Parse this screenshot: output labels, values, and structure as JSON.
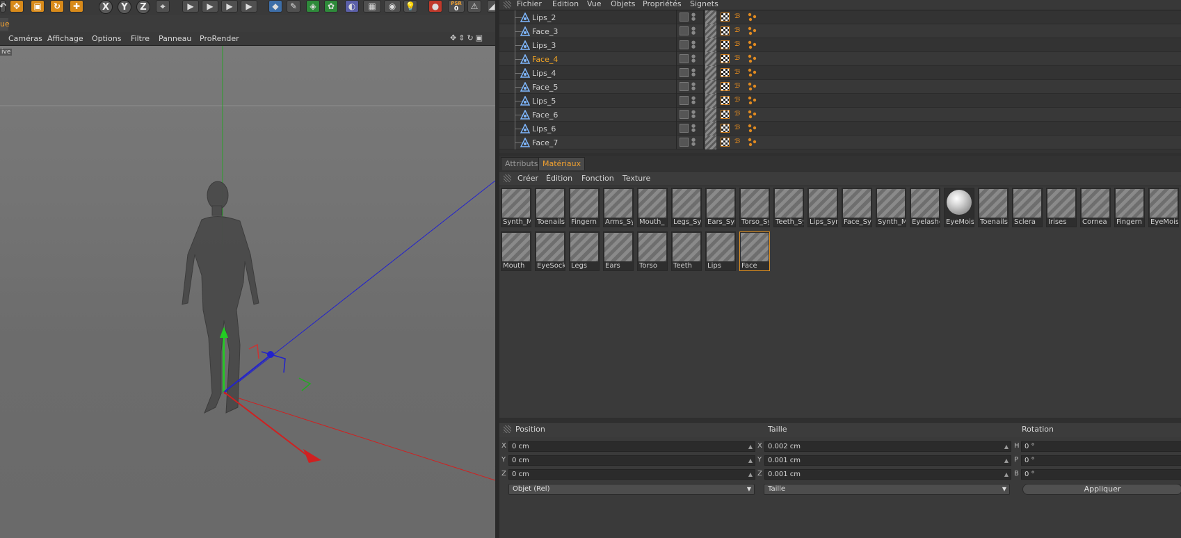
{
  "toolbar": {
    "axis_x": "X",
    "axis_y": "Y",
    "axis_z": "Z",
    "psr_label": "PSR",
    "psr_value": "0"
  },
  "viewport": {
    "tab_label": "ue",
    "menu": [
      "Caméras",
      "Affichage",
      "Options",
      "Filtre",
      "Panneau",
      "ProRender"
    ],
    "label": "ive"
  },
  "object_manager": {
    "menu": [
      "Fichier",
      "Edition",
      "Vue",
      "Objets",
      "Propriétés",
      "Signets"
    ],
    "objects": [
      {
        "name": "Lips_2",
        "selected": false
      },
      {
        "name": "Face_3",
        "selected": false
      },
      {
        "name": "Lips_3",
        "selected": false
      },
      {
        "name": "Face_4",
        "selected": true
      },
      {
        "name": "Lips_4",
        "selected": false
      },
      {
        "name": "Face_5",
        "selected": false
      },
      {
        "name": "Lips_5",
        "selected": false
      },
      {
        "name": "Face_6",
        "selected": false
      },
      {
        "name": "Lips_6",
        "selected": false
      },
      {
        "name": "Face_7",
        "selected": false
      }
    ]
  },
  "panel_tabs": [
    {
      "label": "Attributs",
      "active": false
    },
    {
      "label": "Matériaux",
      "active": true
    }
  ],
  "material_manager": {
    "menu": [
      "Créer",
      "Édition",
      "Fonction",
      "Texture"
    ],
    "row1": [
      "Synth_M",
      "Toenails",
      "Fingern",
      "Arms_Sy",
      "Mouth_",
      "Legs_Sy",
      "Ears_Syn",
      "Torso_Sy",
      "Teeth_Sy",
      "Lips_Syn",
      "Face_Syn",
      "Synth_M",
      "Eyelashe",
      "EyeMois",
      "Toenails",
      "Sclera",
      "Irises",
      "Cornea",
      "Fingern",
      "EyeMois"
    ],
    "row2": [
      "Mouth",
      "EyeSock",
      "Legs",
      "Ears",
      "Torso",
      "Teeth",
      "Lips",
      "Face"
    ],
    "sphere_index": 13,
    "selected_row2_index": 7
  },
  "coordinates": {
    "headers": {
      "position": "Position",
      "size": "Taille",
      "rotation": "Rotation"
    },
    "position": [
      {
        "axis": "X",
        "value": "0 cm"
      },
      {
        "axis": "Y",
        "value": "0 cm"
      },
      {
        "axis": "Z",
        "value": "0 cm"
      }
    ],
    "size": [
      {
        "axis": "X",
        "value": "0.002 cm"
      },
      {
        "axis": "Y",
        "value": "0.001 cm"
      },
      {
        "axis": "Z",
        "value": "0.001 cm"
      }
    ],
    "rotation": [
      {
        "axis": "H",
        "value": "0 °"
      },
      {
        "axis": "P",
        "value": "0 °"
      },
      {
        "axis": "B",
        "value": "0 °"
      }
    ],
    "mode_dropdown": "Objet (Rel)",
    "size_dropdown": "Taille",
    "apply_button": "Appliquer"
  },
  "colors": {
    "accent": "#f0a030",
    "axis_x": "#d02020",
    "axis_y": "#20c020",
    "axis_z": "#2020d0"
  }
}
